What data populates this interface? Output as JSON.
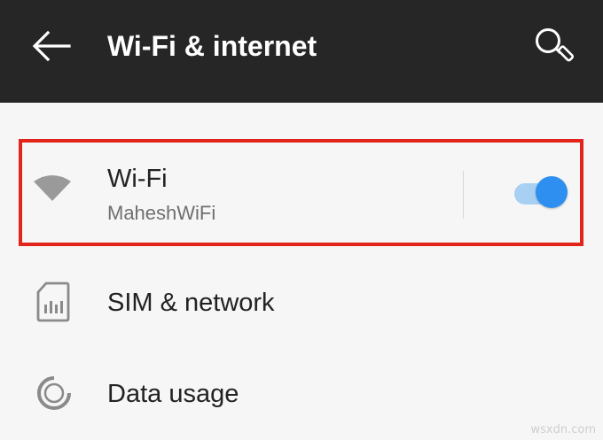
{
  "app_bar": {
    "title": "Wi-Fi & internet",
    "back_icon": "back-arrow-icon",
    "search_icon": "search-icon",
    "background_color": "#262626"
  },
  "settings": {
    "items": [
      {
        "label": "Wi-Fi",
        "sublabel": "MaheshWiFi",
        "icon": "wifi-icon",
        "toggle_on": true
      },
      {
        "label": "SIM & network",
        "icon": "sim-card-icon"
      },
      {
        "label": "Data usage",
        "icon": "data-usage-icon"
      }
    ]
  },
  "colors": {
    "accent": "#2f8ff0",
    "highlight": "#e2241a"
  },
  "watermark": "wsxdn.com"
}
